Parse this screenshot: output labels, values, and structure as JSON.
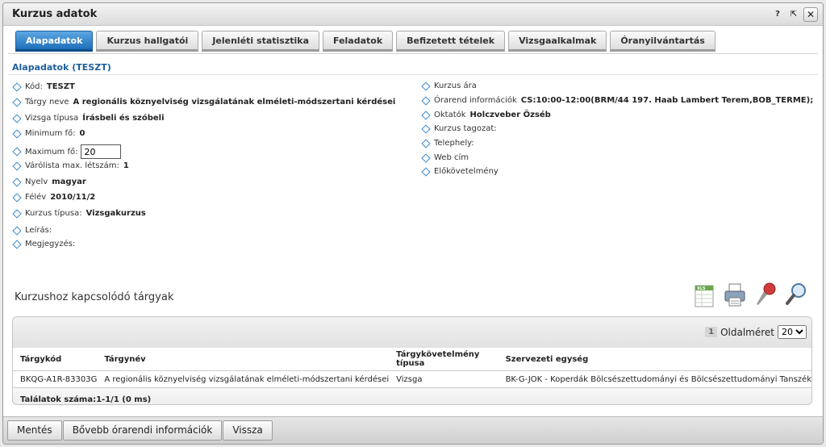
{
  "window": {
    "title": "Kurzus adatok"
  },
  "titlebar_icons": {
    "help": "?",
    "popout": "⇱",
    "close": "✕"
  },
  "tabs": [
    {
      "label": "Alapadatok",
      "active": true
    },
    {
      "label": "Kurzus hallgatói"
    },
    {
      "label": "Jelenléti statisztika"
    },
    {
      "label": "Feladatok"
    },
    {
      "label": "Befizetett tételek"
    },
    {
      "label": "Vizsgaalkalmak"
    },
    {
      "label": "Óranyilvántartás"
    }
  ],
  "section_title": "Alapadatok (TESZT)",
  "left_fields": [
    {
      "label": "Kód:",
      "value": "TESZT"
    },
    {
      "label": "Tárgy neve",
      "value": "A regionális köznyelviség vizsgálatának elméleti-módszertani kérdései"
    },
    {
      "label": "Vizsga típusa",
      "value": "Írásbeli és szóbeli"
    },
    {
      "label": "Minimum fő:",
      "value": "0"
    },
    {
      "label": "Maximum fő:",
      "input_value": "20"
    },
    {
      "label": "Várólista max. létszám:",
      "value": "1"
    },
    {
      "label": "Nyelv",
      "value": "magyar"
    },
    {
      "label": "Félév",
      "value": "2010/11/2"
    },
    {
      "label": "Kurzus típusa:",
      "value": "Vizsgakurzus"
    },
    {
      "label": "Leírás:",
      "value": ""
    },
    {
      "label": "Megjegyzés:",
      "value": ""
    }
  ],
  "right_fields": [
    {
      "label": "Kurzus ára",
      "value": ""
    },
    {
      "label": "Órarend információk",
      "value": "CS:10:00-12:00(BRM/44 197. Haab Lambert Terem,BOB_TERME);"
    },
    {
      "label": "Oktatók",
      "value": "Holczveber Özséb"
    },
    {
      "label": "Kurzus tagozat:",
      "value": ""
    },
    {
      "label": "Telephely:",
      "value": ""
    },
    {
      "label": "Web cím",
      "value": ""
    },
    {
      "label": "Előkövetelmény",
      "value": ""
    }
  ],
  "subheading": "Kurzushoz kapcsolódó tárgyak",
  "toolbar_icons": [
    "excel-export-icon",
    "print-icon",
    "pin-icon",
    "search-icon"
  ],
  "pager": {
    "page": "1",
    "page_size_label": "Oldalméret",
    "page_size": "20"
  },
  "table": {
    "headers": [
      "Tárgykód",
      "Tárgynév",
      "Tárgykövetelmény típusa",
      "Szervezeti egység"
    ],
    "rows": [
      [
        "BKQG-A1R-83303G",
        "A regionális köznyelviség vizsgálatának elméleti-módszertani kérdései",
        "Vizsga",
        "BK-G-JOK - Koperdák Bölcsészettudományi és Bölcsészettudományi Tanszék"
      ]
    ],
    "footer": "Találatok száma:1-1/1 (0 ms)"
  },
  "footer_buttons": [
    "Mentés",
    "Bővebb órarendi információk",
    "Vissza"
  ],
  "colors": {
    "accent": "#1d6fb9",
    "section_title": "#1f5f9b",
    "diamond": "#3a88cc"
  }
}
